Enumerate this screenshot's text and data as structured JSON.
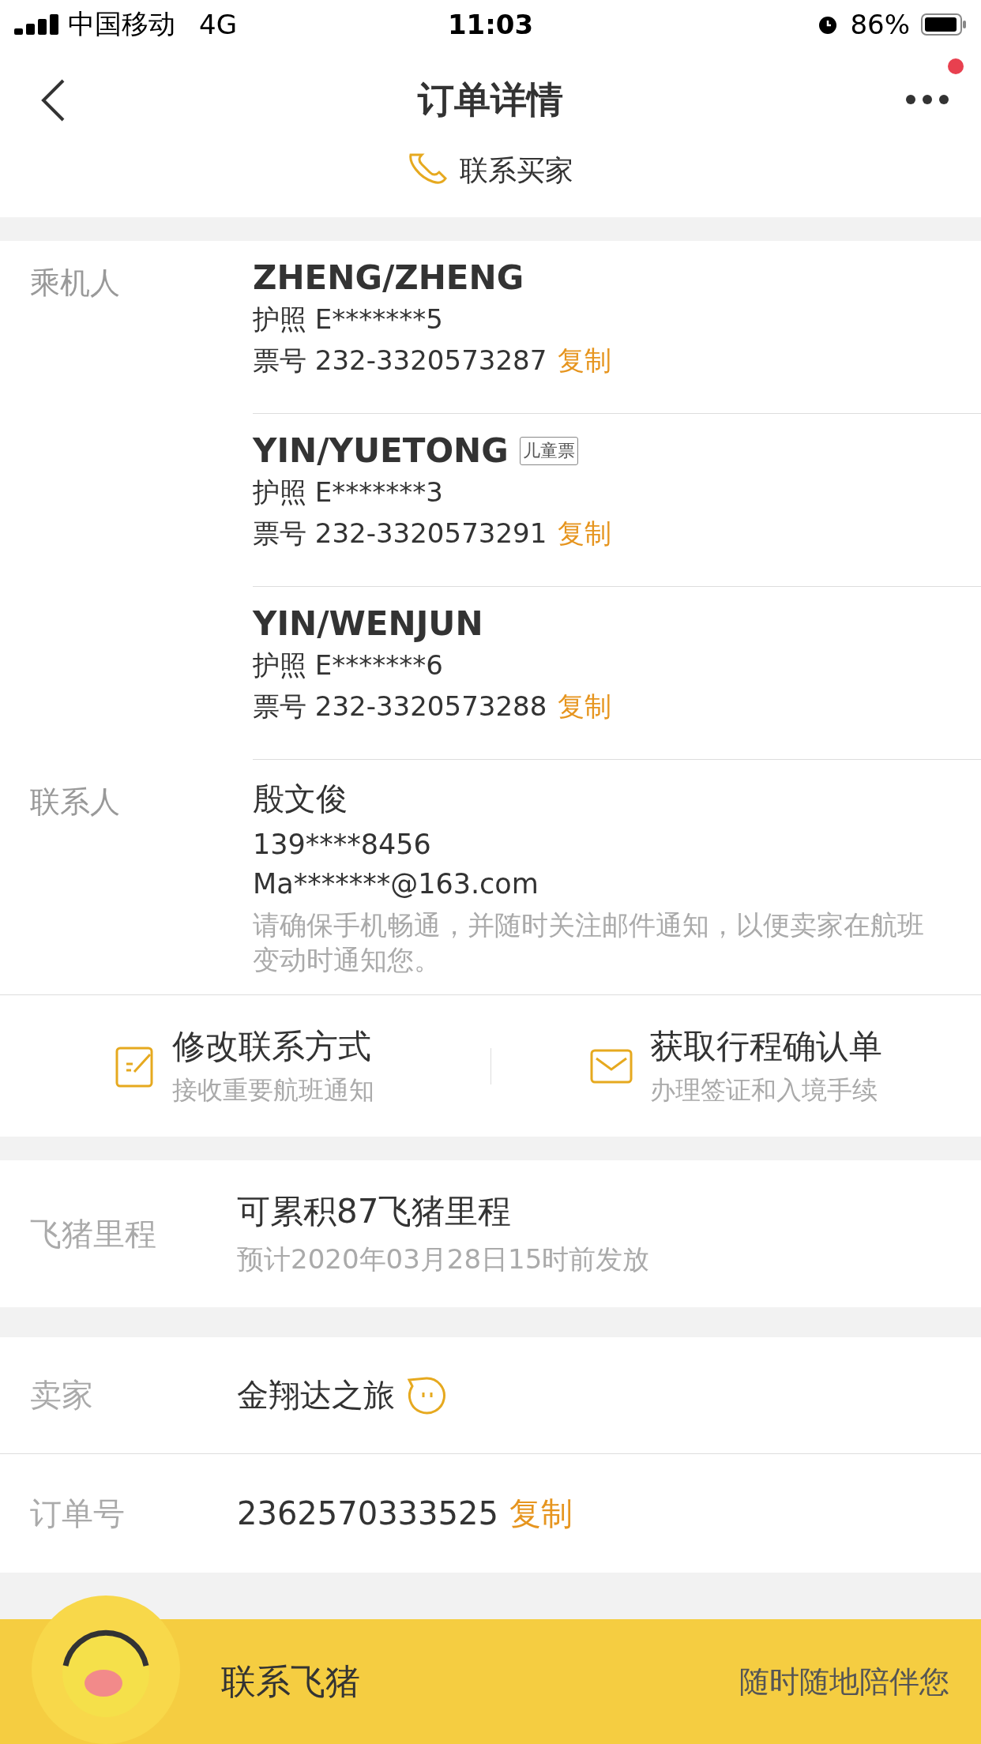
{
  "status_bar": {
    "carrier": "中国移动",
    "network": "4G",
    "time": "11:03",
    "battery": "86%"
  },
  "nav": {
    "title": "订单详情",
    "has_notification": true
  },
  "contact_seller": {
    "label": "联系买家"
  },
  "passengers": {
    "label": "乘机人",
    "items": [
      {
        "name": "ZHENG/ZHENG",
        "passport": "护照 E*******5",
        "ticket": "票号 232-3320573287",
        "copy": "复制"
      },
      {
        "name": "YIN/YUETONG",
        "badge": "儿童票",
        "passport": "护照 E*******3",
        "ticket": "票号 232-3320573291",
        "copy": "复制"
      },
      {
        "name": "YIN/WENJUN",
        "passport": "护照 E*******6",
        "ticket": "票号 232-3320573288",
        "copy": "复制"
      }
    ]
  },
  "contact": {
    "label": "联系人",
    "name": "殷文俊",
    "phone": "139****8456",
    "email": "Ma*******@163.com",
    "notice": "请确保手机畅通，并随时关注邮件通知，以便卖家在航班变动时通知您。"
  },
  "actions": [
    {
      "kind": "edit",
      "title": "修改联系方式",
      "subtitle": "接收重要航班通知"
    },
    {
      "kind": "mail",
      "title": "获取行程确认单",
      "subtitle": "办理签证和入境手续"
    }
  ],
  "miles": {
    "label": "飞猪里程",
    "value": "可累积87飞猪里程",
    "note": "预计2020年03月28日15时前发放"
  },
  "seller": {
    "label": "卖家",
    "value": "金翔达之旅"
  },
  "order": {
    "label": "订单号",
    "value": "2362570333525",
    "copy": "复制"
  },
  "footer": {
    "title": "联系飞猪",
    "subtitle": "随时随地陪伴您"
  }
}
